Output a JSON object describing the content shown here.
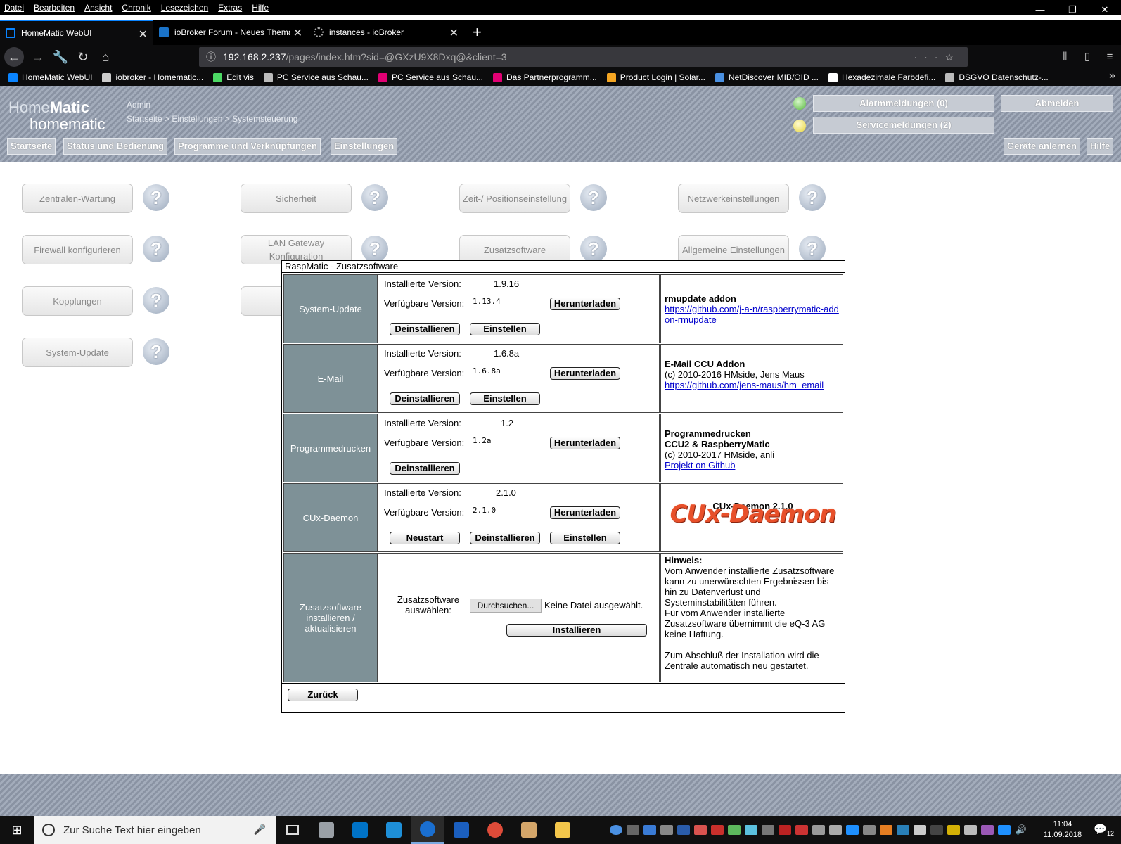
{
  "menubar": [
    "Datei",
    "Bearbeiten",
    "Ansicht",
    "Chronik",
    "Lesezeichen",
    "Extras",
    "Hilfe"
  ],
  "window_controls": [
    "—",
    "❐",
    "✕"
  ],
  "tabs": [
    {
      "title": "HomeMatic WebUI",
      "color": "#0a84ff"
    },
    {
      "title": "ioBroker Forum - Neues Thema",
      "color": "#1a73c8"
    },
    {
      "title": "instances - ioBroker",
      "color": "#8a8a8a"
    }
  ],
  "new_tab": "+",
  "url": {
    "host": "192.168.2.237",
    "path": "/pages/index.htm?sid=@GXzU9X8Dxq@&client=3"
  },
  "bookmarks": [
    {
      "label": "HomeMatic WebUI",
      "color": "#0a84ff"
    },
    {
      "label": "iobroker - Homematic...",
      "color": "#cccccc"
    },
    {
      "label": "Edit vis",
      "color": "#4cd964"
    },
    {
      "label": "PC Service aus Schau...",
      "color": "#bbbbbb"
    },
    {
      "label": "PC Service aus Schau...",
      "color": "#e20074"
    },
    {
      "label": "Das Partnerprogramm...",
      "color": "#e20074"
    },
    {
      "label": "Product Login | Solar...",
      "color": "#f5a623"
    },
    {
      "label": "NetDiscover MIB/OID ...",
      "color": "#4a90e2"
    },
    {
      "label": "Hexadezimale Farbdefi...",
      "color": "#ffffff"
    },
    {
      "label": "DSGVO Datenschutz-...",
      "color": "#bbbbbb"
    }
  ],
  "hm": {
    "logo_top_a": "Home",
    "logo_top_b": "Matic",
    "logo_bottom": "homematic",
    "user": "Admin",
    "breadcrumb": "Startseite > Einstellungen > Systemsteuerung",
    "alarm": "Alarmmeldungen (0)",
    "service": "Servicemeldungen (2)",
    "logout": "Abmelden",
    "nav": [
      "Startseite",
      "Status und Bedienung",
      "Programme und Verknüpfungen",
      "Einstellungen"
    ],
    "teach": "Geräte anlernen",
    "help": "Hilfe"
  },
  "settings_buttons": [
    "Zentralen-Wartung",
    "Sicherheit",
    "Zeit-/ Positionseinstellung",
    "Netzwerkeinstellungen",
    "Firewall konfigurieren",
    "LAN Gateway Konfiguration",
    "Zusatzsoftware",
    "Allgemeine Einstellungen",
    "Kopplungen",
    "",
    "System-Update"
  ],
  "help_glyph": "?",
  "dialog": {
    "title": "RaspMatic - Zusatzsoftware",
    "installed_label": "Installierte Version:",
    "available_label": "Verfügbare Version:",
    "download": "Herunterladen",
    "uninstall": "Deinstallieren",
    "configure": "Einstellen",
    "restart": "Neustart",
    "rows": [
      {
        "name": "System-Update",
        "installed": "1.9.16",
        "available": "1.13.4",
        "info_title": "rmupdate addon",
        "info_link": "https://github.com/j-a-n/raspberrymatic-addon-rmupdate"
      },
      {
        "name": "E-Mail",
        "installed": "1.6.8a",
        "available": "1.6.8a",
        "info_title": "E-Mail CCU Addon",
        "info_text": "(c) 2010-2016 HMside, Jens Maus",
        "info_link": "https://github.com/jens-maus/hm_email"
      },
      {
        "name": "Programmedrucken",
        "installed": "1.2",
        "available": "1.2a",
        "info_title": "Programmedrucken",
        "info_title2": "CCU2 & RaspberryMatic",
        "info_text": "(c) 2010-2017 HMside, anli",
        "info_link": "Projekt on Github"
      },
      {
        "name": "CUx-Daemon",
        "installed": "2.1.0",
        "available": "2.1.0",
        "info_title": "CUx-Daemon 2.1.0",
        "logo_text": "CUx-Daemon"
      }
    ],
    "install": {
      "label": "Zusatzsoftware installieren / aktualisieren",
      "choose": "Zusatzsoftware auswählen:",
      "browse": "Durchsuchen...",
      "no_file": "Keine Datei ausgewählt.",
      "install_btn": "Installieren",
      "hint_title": "Hinweis:",
      "hint_1": "Vom Anwender installierte Zusatzsoftware kann zu unerwünschten Ergebnissen bis hin zu Datenverlust und Systeminstabilitäten führen.",
      "hint_2": "Für vom Anwender installierte Zusatzsoftware übernimmt die eQ-3 AG keine Haftung.",
      "hint_3": "Zum Abschluß der Installation wird die Zentrale automatisch neu gestartet."
    },
    "back": "Zurück"
  },
  "taskbar": {
    "search_placeholder": "Zur Suche Text hier eingeben",
    "apps": [
      "#9aa0a6",
      "#0072c6",
      "#1e8fd8",
      "#1a6fd0",
      "#1b5fbf",
      "#dd4b39",
      "#d4a66a",
      "#f3c64b"
    ],
    "time": "11:04",
    "date": "11.09.2018",
    "notif_count": "12"
  }
}
